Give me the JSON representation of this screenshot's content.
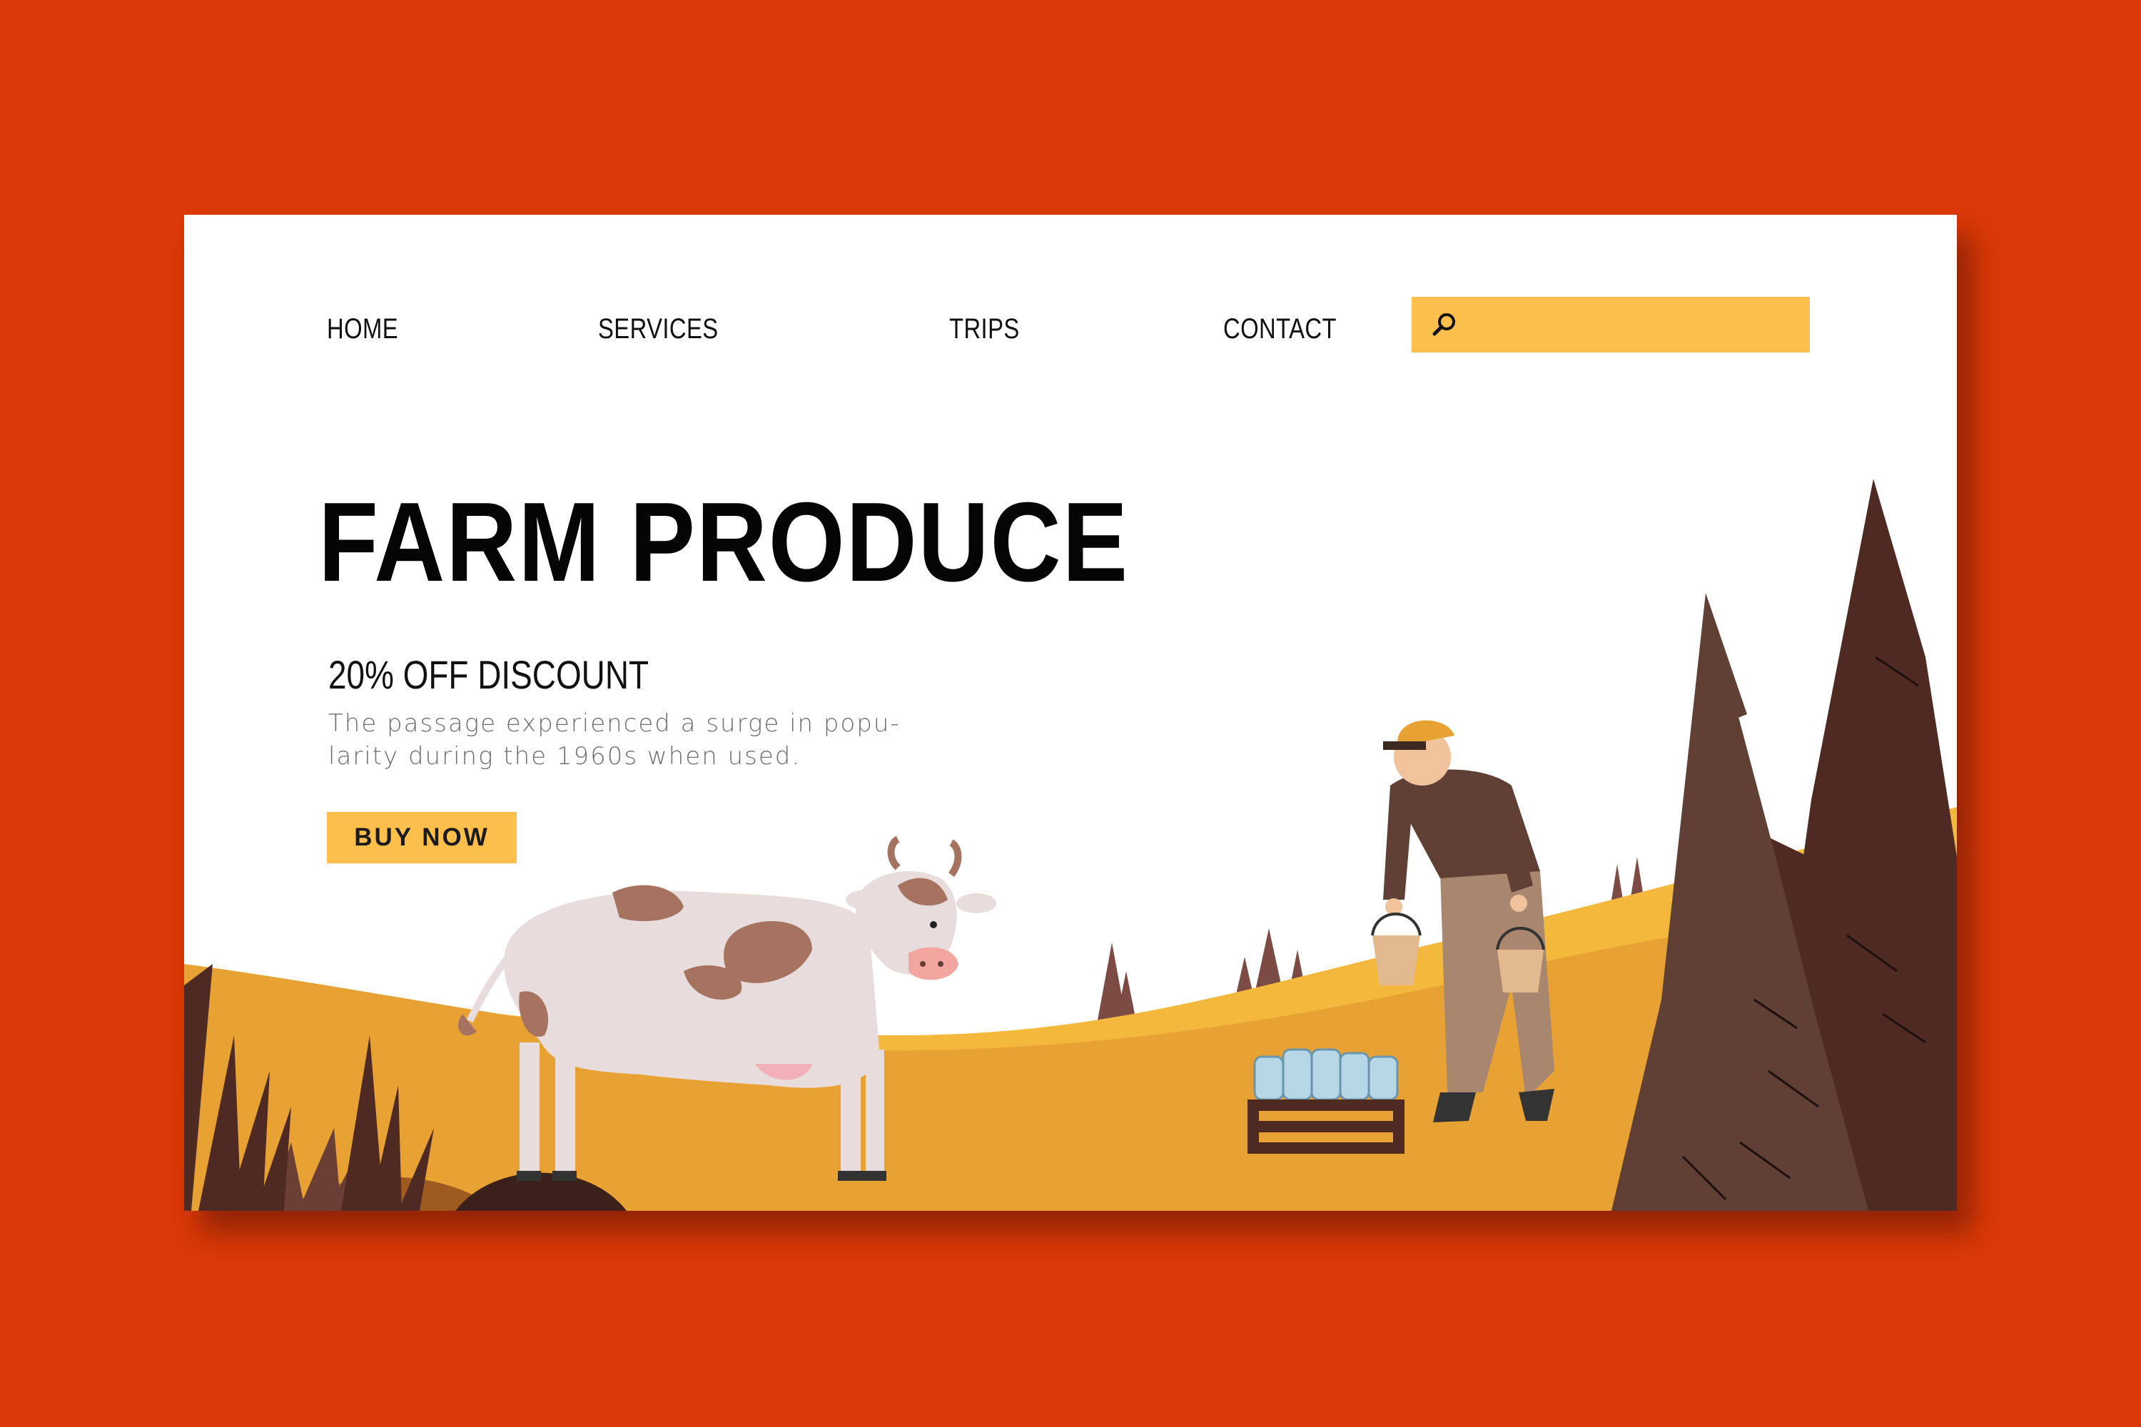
{
  "nav": {
    "items": [
      {
        "label": "HOME",
        "active": true
      },
      {
        "label": "SERVICES",
        "active": false
      },
      {
        "label": "TRIPS",
        "active": false
      },
      {
        "label": "CONTACT",
        "active": false
      }
    ]
  },
  "search": {
    "icon": "search-icon",
    "value": "",
    "placeholder": ""
  },
  "hero": {
    "title": "FARM PRODUCE",
    "subtitle": "20% OFF DISCOUNT",
    "description": "The passage experienced a surge in popu-larity during the 1960s when used.",
    "cta_label": "BUY NOW"
  },
  "colors": {
    "background": "#db3907",
    "accent": "#fdbf4b",
    "field": "#e8a233",
    "tree_dark": "#4e2a23",
    "tree_mid": "#6b3f33"
  }
}
